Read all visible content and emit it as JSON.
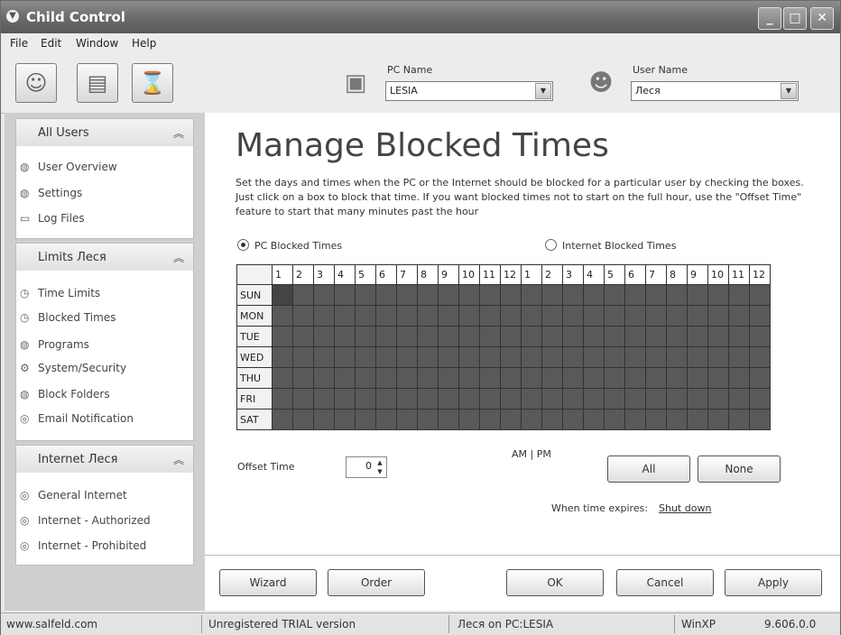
{
  "window": {
    "title": "Child Control"
  },
  "menu": [
    "File",
    "Edit",
    "Window",
    "Help"
  ],
  "toolbar": {
    "pc_name_label": "PC Name",
    "pc_name_value": "LESIA",
    "user_name_label": "User Name",
    "user_name_value": "Леся"
  },
  "sidebar": {
    "panels": [
      {
        "title": "All Users",
        "items": [
          "User Overview",
          "Settings",
          "Log Files"
        ]
      },
      {
        "title": "Limits Леся",
        "items": [
          "Time Limits",
          "Blocked Times",
          "Programs",
          "System/Security",
          "Block Folders",
          "Email Notification"
        ]
      },
      {
        "title": "Internet Леся",
        "items": [
          "General Internet",
          "Internet - Authorized",
          "Internet - Prohibited"
        ]
      }
    ]
  },
  "main": {
    "heading": "Manage Blocked Times",
    "description": "Set the days and times when the PC or the Internet should be blocked for a particular user by checking the boxes. Just click on a box to block that time. If you want blocked times not to start on the full hour, use the \"Offset Time\" feature to start that many minutes past the hour",
    "radio_pc": "PC Blocked Times",
    "radio_internet": "Internet Blocked Times",
    "hours": [
      "1",
      "2",
      "3",
      "4",
      "5",
      "6",
      "7",
      "8",
      "9",
      "10",
      "11",
      "12",
      "1",
      "2",
      "3",
      "4",
      "5",
      "6",
      "7",
      "8",
      "9",
      "10",
      "11",
      "12"
    ],
    "days": [
      "SUN",
      "MON",
      "TUE",
      "WED",
      "THU",
      "FRI",
      "SAT"
    ],
    "ampm_label": "AM | PM",
    "offset_label": "Offset Time",
    "offset_value": "0",
    "all_button": "All",
    "none_button": "None",
    "expires_label": "When time expires:",
    "expires_action": "Shut down",
    "colors": {
      "blocked": "#595959",
      "selected": "#444444"
    }
  },
  "footer_buttons": {
    "wizard": "Wizard",
    "order": "Order",
    "ok": "OK",
    "cancel": "Cancel",
    "apply": "Apply"
  },
  "status": {
    "site": "www.salfeld.com",
    "version_note": "Unregistered TRIAL version",
    "user_on_pc": "Леся on PC:LESIA",
    "os": "WinXP",
    "build": "9.606.0.0"
  }
}
